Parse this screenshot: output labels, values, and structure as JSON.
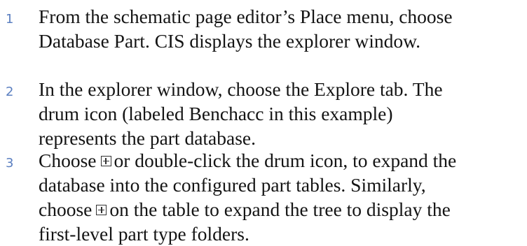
{
  "steps": [
    {
      "number": "1",
      "lines": [
        "From the schematic page editor’s Place menu, choose",
        "Database Part. CIS displays the explorer window."
      ]
    },
    {
      "number": "2",
      "lines": [
        "In the explorer window, choose the Explore tab. The",
        "drum icon (labeled Benchacc in this example)",
        "represents the part database."
      ]
    },
    {
      "number": "3",
      "line1_before": "Choose",
      "line1_after": "or double-click the drum icon, to expand the",
      "line2": "database into the configured part tables. Similarly,",
      "line3_before": "choose",
      "line3_after": "on the table to expand the tree to display the",
      "line4": "first-level part type folders.",
      "icon": "expand-plus-icon"
    }
  ]
}
